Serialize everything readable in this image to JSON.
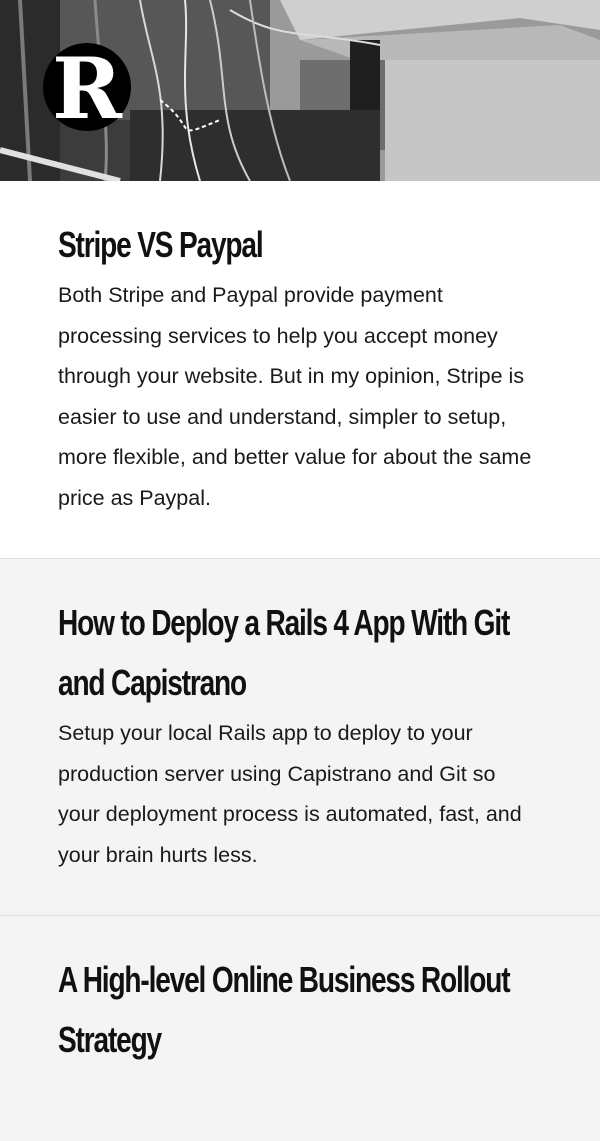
{
  "site": {
    "logo_letter": "R"
  },
  "posts": [
    {
      "title": "Stripe VS Paypal",
      "excerpt": "Both Stripe and Paypal provide payment processing services to help you accept money through your website. But in my opinion, Stripe is easier to use and understand, simpler to setup, more flexible, and better value for about the same price as Paypal."
    },
    {
      "title": "How to Deploy a Rails 4 App With Git and Capistrano",
      "excerpt": "Setup your local Rails app to deploy to your production server using Capistrano and Git so your deployment process is automated, fast, and your brain hurts less."
    },
    {
      "title": "A High-level Online Business Rollout Strategy",
      "excerpt": ""
    }
  ],
  "colors": {
    "page_background": "#f4f4f4",
    "featured_background": "#ffffff",
    "text": "#111111",
    "logo_background": "#000000"
  }
}
